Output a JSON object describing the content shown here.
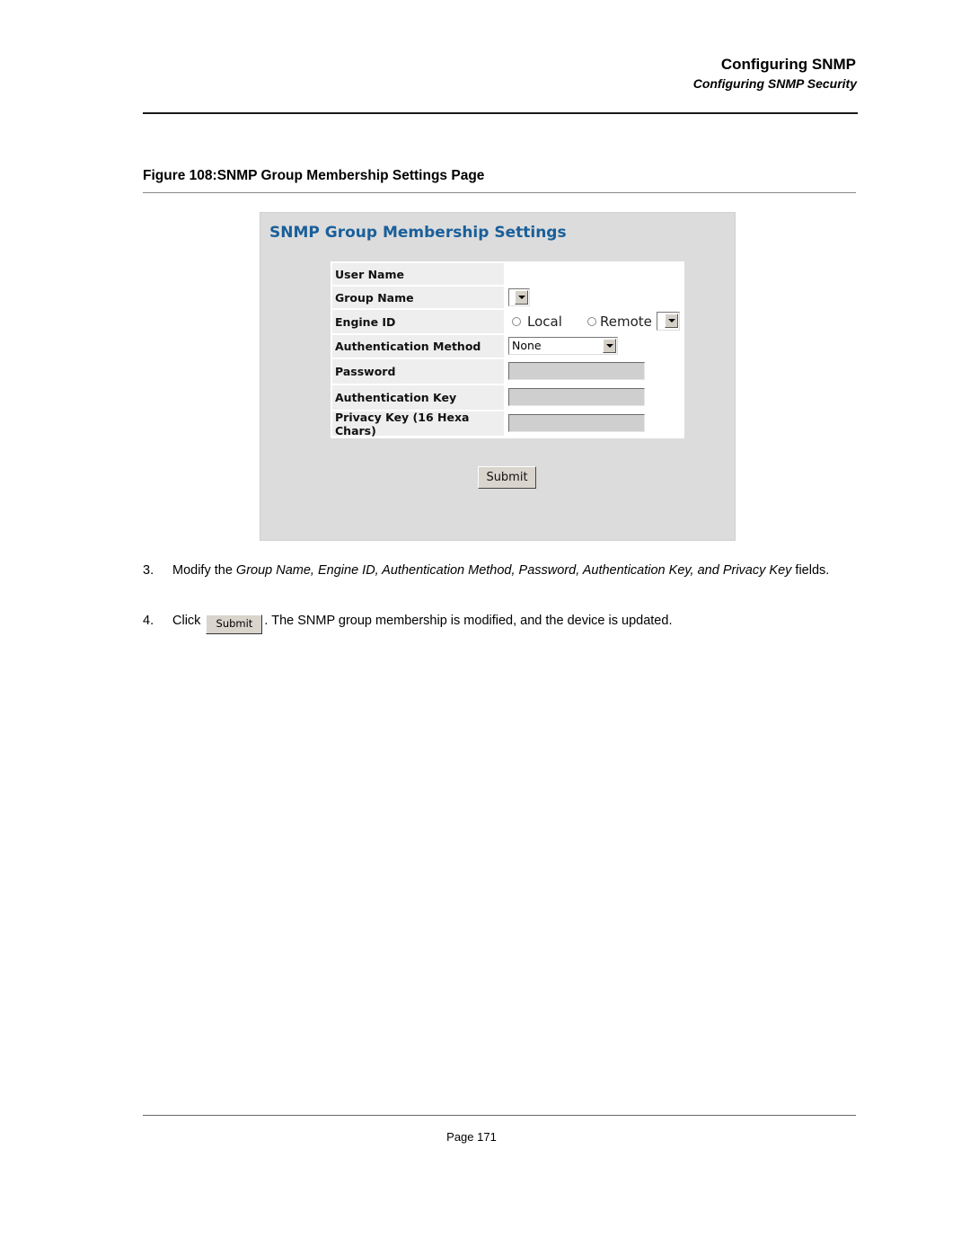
{
  "header": {
    "chapter": "Configuring SNMP",
    "section": "Configuring SNMP Security"
  },
  "figure": {
    "caption": "Figure 108:SNMP Group Membership Settings Page"
  },
  "screen": {
    "title": "SNMP Group Membership Settings",
    "fields": {
      "user_name": {
        "label": "User Name",
        "value": ""
      },
      "group_name": {
        "label": "Group Name",
        "value": ""
      },
      "engine_id": {
        "label": "Engine ID",
        "options": [
          "Local",
          "Remote"
        ],
        "selected": "",
        "remote_value": ""
      },
      "auth_method": {
        "label": "Authentication Method",
        "value": "None"
      },
      "password": {
        "label": "Password",
        "value": ""
      },
      "auth_key": {
        "label": "Authentication Key",
        "value": ""
      },
      "privacy_key": {
        "label": "Privacy Key (16 Hexa Chars)",
        "value": ""
      }
    },
    "submit_label": "Submit"
  },
  "steps": [
    {
      "number": "3.",
      "prefix": "Modify the ",
      "italic": "Group Name, Engine ID, Authentication Method, Password, Authentication Key, and Privacy Key",
      "suffix": " fields."
    },
    {
      "number": "4.",
      "prefix": "Click",
      "button_label": "Submit",
      "suffix": ". The SNMP group membership is modified, and the device is updated."
    }
  ],
  "footer": {
    "page": "Page 171"
  }
}
